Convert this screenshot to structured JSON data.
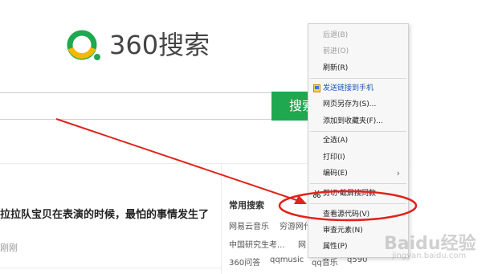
{
  "logo": {
    "text": "360搜索",
    "icon": "360-logo-icon"
  },
  "search": {
    "button_label": "搜索",
    "value": ""
  },
  "news": {
    "headline": "拉拉队宝贝在表演的时候，最怕的事情发生了",
    "source": "刚刚"
  },
  "common_search": {
    "title": "常用搜索",
    "tags": [
      "网易云音乐",
      "穷游网代",
      "中国研究生考...",
      "网",
      "360问答",
      "qqmusic",
      "qq音乐",
      "q590"
    ]
  },
  "context_menu": {
    "items": [
      {
        "label": "后退(B)",
        "state": "disabled"
      },
      {
        "label": "前进(O)",
        "state": "disabled"
      },
      {
        "label": "刷新(R)",
        "state": "normal"
      },
      {
        "label": "发送链接到手机",
        "state": "link",
        "icon": "phone-icon"
      },
      {
        "label": "网页另存为(S)...",
        "state": "normal"
      },
      {
        "label": "添加到收藏夹(F)...",
        "state": "normal"
      },
      {
        "label": "全选(A)",
        "state": "normal"
      },
      {
        "label": "打印(I)",
        "state": "normal"
      },
      {
        "label": "编码(E)",
        "state": "normal",
        "submenu": "chevron-right-icon"
      },
      {
        "label": "剪切·截屏搜同款",
        "state": "normal",
        "icon": "scissors-icon"
      },
      {
        "label": "查看源代码(V)",
        "state": "normal"
      },
      {
        "label": "审查元素(N)",
        "state": "normal"
      },
      {
        "label": "属性(P)",
        "state": "normal"
      }
    ]
  },
  "watermark": {
    "text": "Baidu经验",
    "sub": "jingyan.baidu.com"
  },
  "colors": {
    "brand_green": "#1fa84f",
    "logo_yellow": "#f5b800",
    "annotation_red": "#e0231b"
  }
}
